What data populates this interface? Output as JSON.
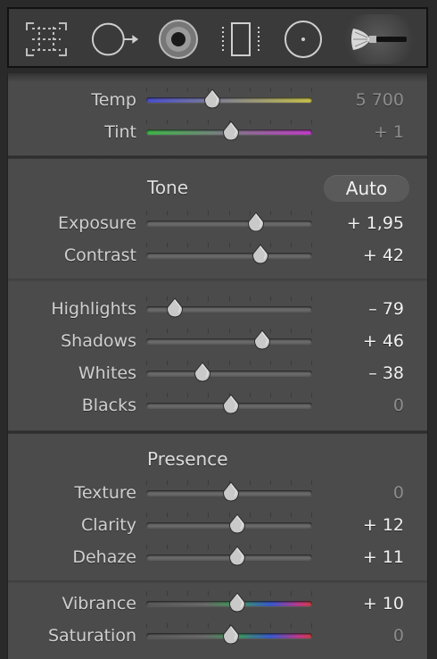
{
  "toolbar": {
    "tools": [
      {
        "icon": "crop-overlay-icon",
        "active": false
      },
      {
        "icon": "spot-removal-icon",
        "active": false
      },
      {
        "icon": "red-eye-icon",
        "active": false
      },
      {
        "icon": "graduated-filter-icon",
        "active": false
      },
      {
        "icon": "radial-filter-icon",
        "active": false
      },
      {
        "icon": "adjustment-brush-icon",
        "active": true
      }
    ]
  },
  "white_balance": {
    "temp": {
      "label": "Temp",
      "value": "5 700",
      "level": 0.4,
      "colors": [
        "#4a4fd0",
        "#c9c24a"
      ]
    },
    "tint": {
      "label": "Tint",
      "value": "+ 1",
      "level": 0.51,
      "colors": [
        "#3fb84a",
        "#c33cc8"
      ]
    }
  },
  "tone": {
    "title": "Tone",
    "auto_label": "Auto",
    "exposure": {
      "label": "Exposure",
      "value": "+ 1,95",
      "level": 0.66
    },
    "contrast": {
      "label": "Contrast",
      "value": "+ 42",
      "level": 0.69
    },
    "highlights": {
      "label": "Highlights",
      "value": "– 79",
      "level": 0.17
    },
    "shadows": {
      "label": "Shadows",
      "value": "+ 46",
      "level": 0.7
    },
    "whites": {
      "label": "Whites",
      "value": "– 38",
      "level": 0.34
    },
    "blacks": {
      "label": "Blacks",
      "value": "0",
      "level": 0.51
    }
  },
  "presence": {
    "title": "Presence",
    "texture": {
      "label": "Texture",
      "value": "0",
      "level": 0.51
    },
    "clarity": {
      "label": "Clarity",
      "value": "+ 12",
      "level": 0.55
    },
    "dehaze": {
      "label": "Dehaze",
      "value": "+ 11",
      "level": 0.55
    },
    "vibrance": {
      "label": "Vibrance",
      "value": "+ 10",
      "level": 0.55
    },
    "saturation": {
      "label": "Saturation",
      "value": "0",
      "level": 0.51
    }
  },
  "colors": {
    "panel_bg": "#4b4b4b",
    "toolbar_bg": "#3a3a3a",
    "text": "#cfcfcf",
    "value_dim": "#8c8c8c",
    "value_bright": "#f0f0f0"
  }
}
